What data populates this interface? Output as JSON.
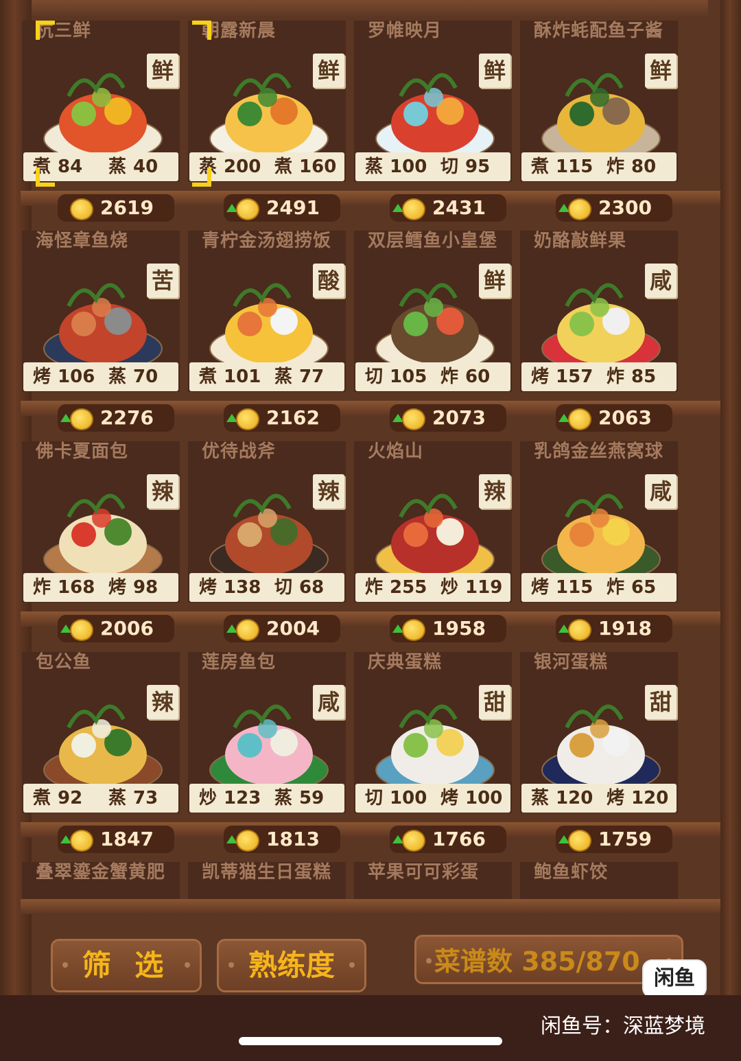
{
  "dishes": [
    {
      "name": "杭三鲜",
      "taste": "鲜",
      "s1": "煮",
      "v1": "84",
      "s2": "蒸",
      "v2": "40",
      "score": "2619",
      "up": false
    },
    {
      "name": "朝露新晨",
      "taste": "鲜",
      "s1": "蒸",
      "v1": "200",
      "s2": "煮",
      "v2": "160",
      "score": "2491",
      "up": true
    },
    {
      "name": "罗帷映月",
      "taste": "鲜",
      "s1": "蒸",
      "v1": "100",
      "s2": "切",
      "v2": "95",
      "score": "2431",
      "up": true
    },
    {
      "name": "酥炸蚝配鱼子酱",
      "taste": "鲜",
      "s1": "煮",
      "v1": "115",
      "s2": "炸",
      "v2": "80",
      "score": "2300",
      "up": true
    },
    {
      "name": "海怪章鱼烧",
      "taste": "苦",
      "s1": "烤",
      "v1": "106",
      "s2": "蒸",
      "v2": "70",
      "score": "2276",
      "up": true
    },
    {
      "name": "青柠金汤翅捞饭",
      "taste": "酸",
      "s1": "煮",
      "v1": "101",
      "s2": "蒸",
      "v2": "77",
      "score": "2162",
      "up": true
    },
    {
      "name": "双层鳕鱼小皇堡",
      "taste": "鲜",
      "s1": "切",
      "v1": "105",
      "s2": "炸",
      "v2": "60",
      "score": "2073",
      "up": true
    },
    {
      "name": "奶酪敲鲜果",
      "taste": "咸",
      "s1": "烤",
      "v1": "157",
      "s2": "炸",
      "v2": "85",
      "score": "2063",
      "up": true
    },
    {
      "name": "佛卡夏面包",
      "taste": "辣",
      "s1": "炸",
      "v1": "168",
      "s2": "烤",
      "v2": "98",
      "score": "2006",
      "up": true
    },
    {
      "name": "优待战斧",
      "taste": "辣",
      "s1": "烤",
      "v1": "138",
      "s2": "切",
      "v2": "68",
      "score": "2004",
      "up": true
    },
    {
      "name": "火焰山",
      "taste": "辣",
      "s1": "炸",
      "v1": "255",
      "s2": "炒",
      "v2": "119",
      "score": "1958",
      "up": true
    },
    {
      "name": "乳鸽金丝燕窝球",
      "taste": "咸",
      "s1": "烤",
      "v1": "115",
      "s2": "炸",
      "v2": "65",
      "score": "1918",
      "up": true
    },
    {
      "name": "包公鱼",
      "taste": "辣",
      "s1": "煮",
      "v1": "92",
      "s2": "蒸",
      "v2": "73",
      "score": "1847",
      "up": true
    },
    {
      "name": "莲房鱼包",
      "taste": "咸",
      "s1": "炒",
      "v1": "123",
      "s2": "蒸",
      "v2": "59",
      "score": "1813",
      "up": true
    },
    {
      "name": "庆典蛋糕",
      "taste": "甜",
      "s1": "切",
      "v1": "100",
      "s2": "烤",
      "v2": "100",
      "score": "1766",
      "up": true
    },
    {
      "name": "银河蛋糕",
      "taste": "甜",
      "s1": "蒸",
      "v1": "120",
      "s2": "烤",
      "v2": "120",
      "score": "1759",
      "up": true
    }
  ],
  "partial_dishes": [
    "叠翠鎏金蟹黄肥",
    "凯蒂猫生日蛋糕",
    "苹果可可彩蛋",
    "鲍鱼虾饺"
  ],
  "buttons": {
    "filter": "筛 选",
    "proficiency": "熟练度",
    "recipe_count": "菜谱数 385/870"
  },
  "logo": "闲鱼",
  "watermark": "闲鱼号：深蓝梦境",
  "colors": {
    "accent": "#f5b51a",
    "card_bg": "#4a2b1d",
    "label_bg": "#f3ead3",
    "coin": "#e8a81a"
  }
}
